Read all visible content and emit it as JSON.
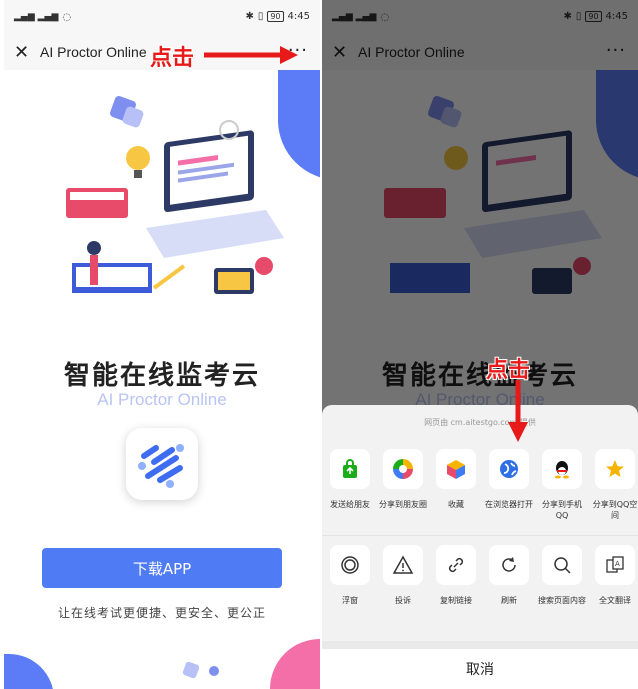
{
  "status": {
    "time": "4:45",
    "battery": "90"
  },
  "nav": {
    "title": "AI Proctor Online",
    "more": "···"
  },
  "annotation": {
    "tap": "点击"
  },
  "landing": {
    "headline": "智能在线监考云",
    "subtitle": "AI Proctor Online",
    "download_label": "下载APP",
    "tagline": "让在线考试更便捷、更安全、更公正"
  },
  "share_sheet": {
    "hint": "网页由 cm.aitestgo.com 提供",
    "row1": [
      {
        "label": "发送给朋友",
        "icon": "wechat-bag-icon"
      },
      {
        "label": "分享到朋友圈",
        "icon": "moments-icon"
      },
      {
        "label": "收藏",
        "icon": "favorite-cube-icon"
      },
      {
        "label": "在浏览器打开",
        "icon": "browser-icon"
      },
      {
        "label": "分享到手机QQ",
        "icon": "qq-icon"
      },
      {
        "label": "分享到QQ空间",
        "icon": "qzone-star-icon"
      }
    ],
    "row2": [
      {
        "label": "浮窗",
        "icon": "float-window-icon"
      },
      {
        "label": "投诉",
        "icon": "warning-icon"
      },
      {
        "label": "复制链接",
        "icon": "link-icon"
      },
      {
        "label": "刷新",
        "icon": "refresh-icon"
      },
      {
        "label": "搜索页面内容",
        "icon": "search-icon"
      },
      {
        "label": "全文翻译",
        "icon": "translate-icon"
      }
    ],
    "cancel_label": "取消"
  },
  "colors": {
    "primary": "#4f7cf5",
    "annotation": "#e81919",
    "pink": "#f46fa8"
  }
}
